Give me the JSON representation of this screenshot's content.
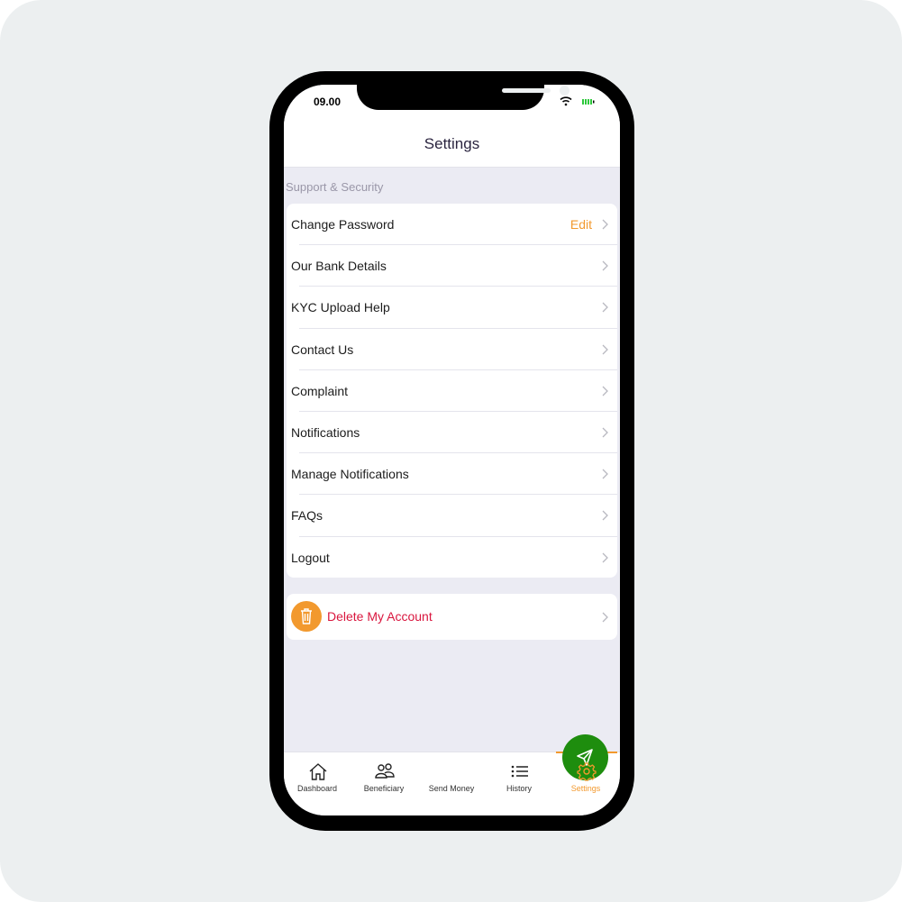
{
  "status_bar": {
    "time": "09.00",
    "wifi_icon": "wifi-icon",
    "battery_icon": "battery-icon",
    "battery_color": "#2ec93c"
  },
  "header": {
    "title": "Settings"
  },
  "section_title": "Support & Security",
  "menu_items": [
    {
      "label": "Change Password",
      "action": "Edit"
    },
    {
      "label": "Our Bank Details"
    },
    {
      "label": "KYC Upload Help"
    },
    {
      "label": "Contact Us"
    },
    {
      "label": "Complaint"
    },
    {
      "label": "Notifications"
    },
    {
      "label": "Manage Notifications"
    },
    {
      "label": "FAQs"
    },
    {
      "label": "Logout"
    }
  ],
  "delete_account": {
    "label": "Delete My Account",
    "icon": "trash-icon",
    "color": "#d9163e"
  },
  "tabbar": {
    "tabs": [
      {
        "label": "Dashboard",
        "icon": "home-icon"
      },
      {
        "label": "Beneficiary",
        "icon": "users-icon"
      },
      {
        "label": "Send Money",
        "icon": "send-icon"
      },
      {
        "label": "History",
        "icon": "list-icon"
      },
      {
        "label": "Settings",
        "icon": "gear-icon",
        "active": true
      }
    ]
  },
  "colors": {
    "accent": "#f2992e",
    "fab": "#1e8d0e"
  }
}
